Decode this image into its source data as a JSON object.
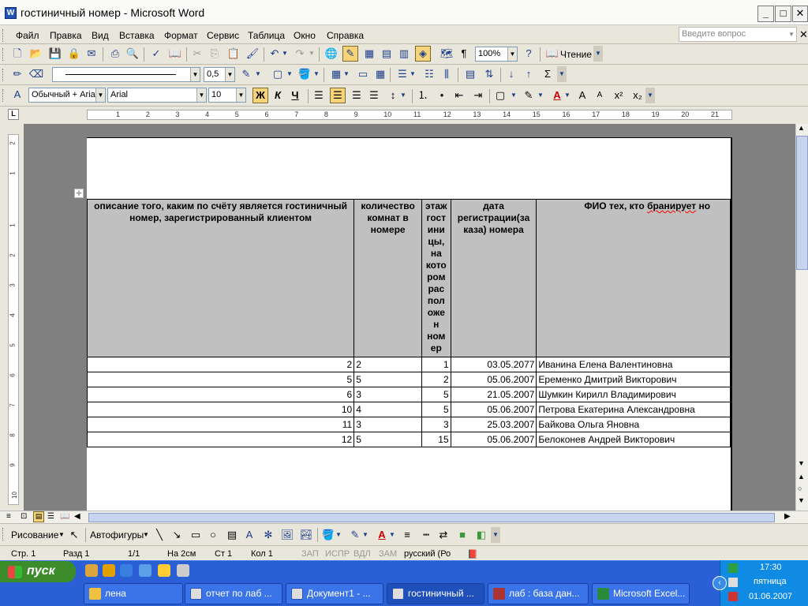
{
  "window": {
    "title": "гостиничный номер - Microsoft Word"
  },
  "menu": {
    "items": [
      "Файл",
      "Правка",
      "Вид",
      "Вставка",
      "Формат",
      "Сервис",
      "Таблица",
      "Окно",
      "Справка"
    ],
    "help_placeholder": "Введите вопрос"
  },
  "toolbar": {
    "zoom": "100%",
    "read_label": "Чтение"
  },
  "tables_toolbar": {
    "line_weight": "0,5"
  },
  "formatting": {
    "style": "Обычный + Aria",
    "font": "Arial",
    "size": "10"
  },
  "ruler": {
    "marks": [
      "1",
      "2",
      "3",
      "4",
      "5",
      "6",
      "7",
      "8",
      "9",
      "10",
      "11",
      "12",
      "13",
      "14",
      "15",
      "16",
      "17",
      "18",
      "19",
      "20",
      "21"
    ],
    "vmarks": [
      "2",
      "1",
      "1",
      "2",
      "3",
      "4",
      "5",
      "6",
      "7",
      "8",
      "9",
      "10"
    ]
  },
  "doc_table": {
    "headers": [
      "описание того, каким по счёту является гостиничный номер, зарегистрированный клиентом",
      "количество комнат в номере",
      "этаж гост ини цы, на кото ром рас пол оже н ном ер",
      "дата регистрации(за каза) номера",
      "ФИО тех, кто бранирует номер"
    ],
    "rows": [
      [
        "2",
        "2",
        "1",
        "03.05.2077",
        "Иванина Елена Валентиновна"
      ],
      [
        "5",
        "5",
        "2",
        "05.06.2007",
        "Еременко Дмитрий Викторович"
      ],
      [
        "6",
        "3",
        "5",
        "21.05.2007",
        "Шумкин Кирилл Владимирович"
      ],
      [
        "10",
        "4",
        "5",
        "05.06.2007",
        "Петрова Екатерина Александровна"
      ],
      [
        "11",
        "3",
        "3",
        "25.03.2007",
        "Байкова Ольга Яновна"
      ],
      [
        "12",
        "5",
        "15",
        "05.06.2007",
        "Белоконев Андрей Викторович"
      ]
    ]
  },
  "drawing": {
    "draw_label": "Рисование",
    "autoshapes_label": "Автофигуры"
  },
  "status": {
    "page": "Стр. 1",
    "section": "Разд 1",
    "pages": "1/1",
    "at": "На 2см",
    "line": "Ст 1",
    "col": "Кол 1",
    "rec": "ЗАП",
    "trk": "ИСПР",
    "ext": "ВДЛ",
    "ovr": "ЗАМ",
    "lang": "русский (Ро"
  },
  "taskbar": {
    "start_label": "пуск",
    "buttons": [
      "лена",
      "отчет по лаб ...",
      "Документ1 - ...",
      "гостиничный ...",
      "лаб : база дан...",
      "Microsoft Excel..."
    ],
    "time": "17:30",
    "day": "пятница",
    "date": "01.06.2007"
  },
  "colors": {
    "taskbar": "#2a5fd6",
    "start": "#3c8c2c",
    "header_fill": "#c0c0c0"
  }
}
